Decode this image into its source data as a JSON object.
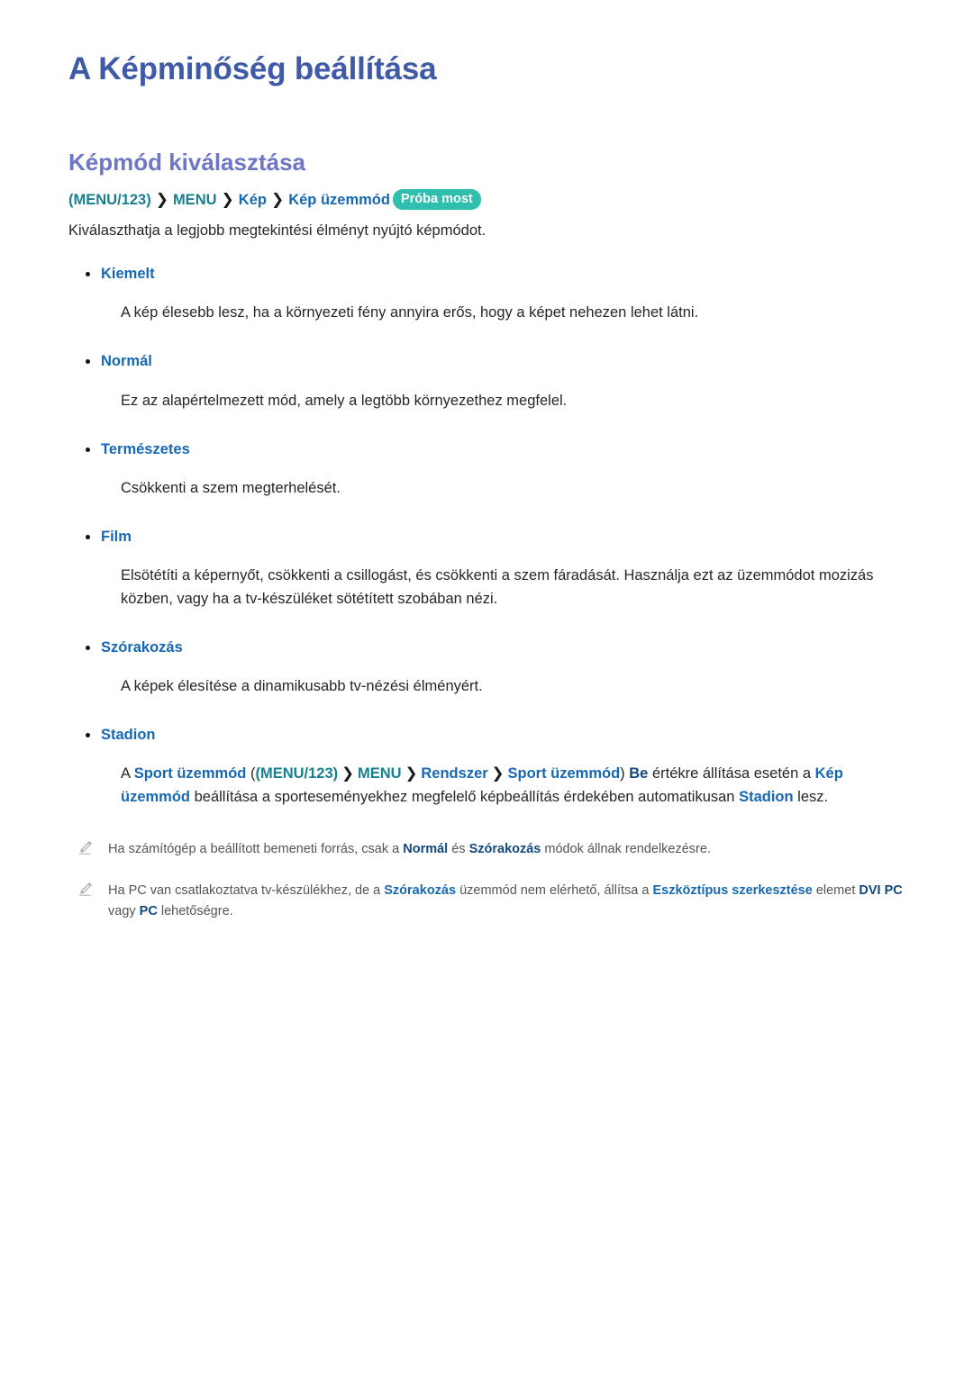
{
  "document": {
    "title": "A Képminőség beállítása",
    "section_title": "Képmód kiválasztása"
  },
  "menu_path": {
    "items": [
      {
        "label": "(MENU/123)",
        "style": "teal"
      },
      {
        "label": "MENU",
        "style": "teal"
      },
      {
        "label": "Kép",
        "style": "blue"
      },
      {
        "label": "Kép üzemmód",
        "style": "blue"
      }
    ],
    "separator": "❯",
    "try_now_badge": "Próba most"
  },
  "intro": "Kiválaszthatja a legjobb megtekintési élményt nyújtó képmódot.",
  "modes": [
    {
      "name": "Kiemelt",
      "description": "A kép élesebb lesz, ha a környezeti fény annyira erős, hogy a képet nehezen lehet látni."
    },
    {
      "name": "Normál",
      "description": "Ez az alapértelmezett mód, amely a legtöbb környezethez megfelel."
    },
    {
      "name": "Természetes",
      "description": "Csökkenti a szem megterhelését."
    },
    {
      "name": "Film",
      "description": "Elsötétíti a képernyőt, csökkenti a csillogást, és csökkenti a szem fáradását. Használja ezt az üzemmódot mozizás közben, vagy ha a tv-készüléket sötétített szobában nézi."
    },
    {
      "name": "Szórakozás",
      "description": "A képek élesítése a dinamikusabb tv-nézési élményért."
    },
    {
      "name": "Stadion",
      "description": ""
    }
  ],
  "stadion_paragraph": {
    "t1": "A ",
    "sport_mode_1": "Sport üzemmód",
    "t2": " (",
    "menu123": "(MENU/123)",
    "sep1": "❯",
    "menu": "MENU",
    "sep2": "❯",
    "rendszer": "Rendszer",
    "sep3": "❯",
    "sport_mode_2": "Sport üzemmód",
    "t3": ") ",
    "be": "Be",
    "t4": " értékre állítása esetén a ",
    "kep_uzemmod": "Kép üzemmód",
    "t5": " beállítása a sporteseményekhez megfelelő képbeállítás érdekében automatikusan ",
    "stadion": "Stadion",
    "t6": " lesz."
  },
  "notes": [
    {
      "icon": "pencil-icon",
      "t1": "Ha számítógép a beállított bemeneti forrás, csak a ",
      "b1": "Normál",
      "t2": " és ",
      "b2": "Szórakozás",
      "t3": " módok állnak rendelkezésre."
    },
    {
      "icon": "pencil-icon",
      "t1": "Ha PC van csatlakoztatva tv-készülékhez, de a ",
      "b1": "Szórakozás",
      "t2": " üzemmód nem elérhető, állítsa a ",
      "b2": "Eszköztípus szerkesztése",
      "t3": " elemet ",
      "b3": "DVI PC",
      "t4": " vagy ",
      "b4": "PC",
      "t5": " lehetőségre."
    }
  ],
  "colors": {
    "title": "#3f5aa6",
    "section_title": "#6e77c6",
    "link_blue": "#1668b3",
    "navy": "#11487e",
    "teal": "#18808f",
    "badge_bg": "#2ebfae",
    "body": "#262626",
    "note": "#555555"
  }
}
